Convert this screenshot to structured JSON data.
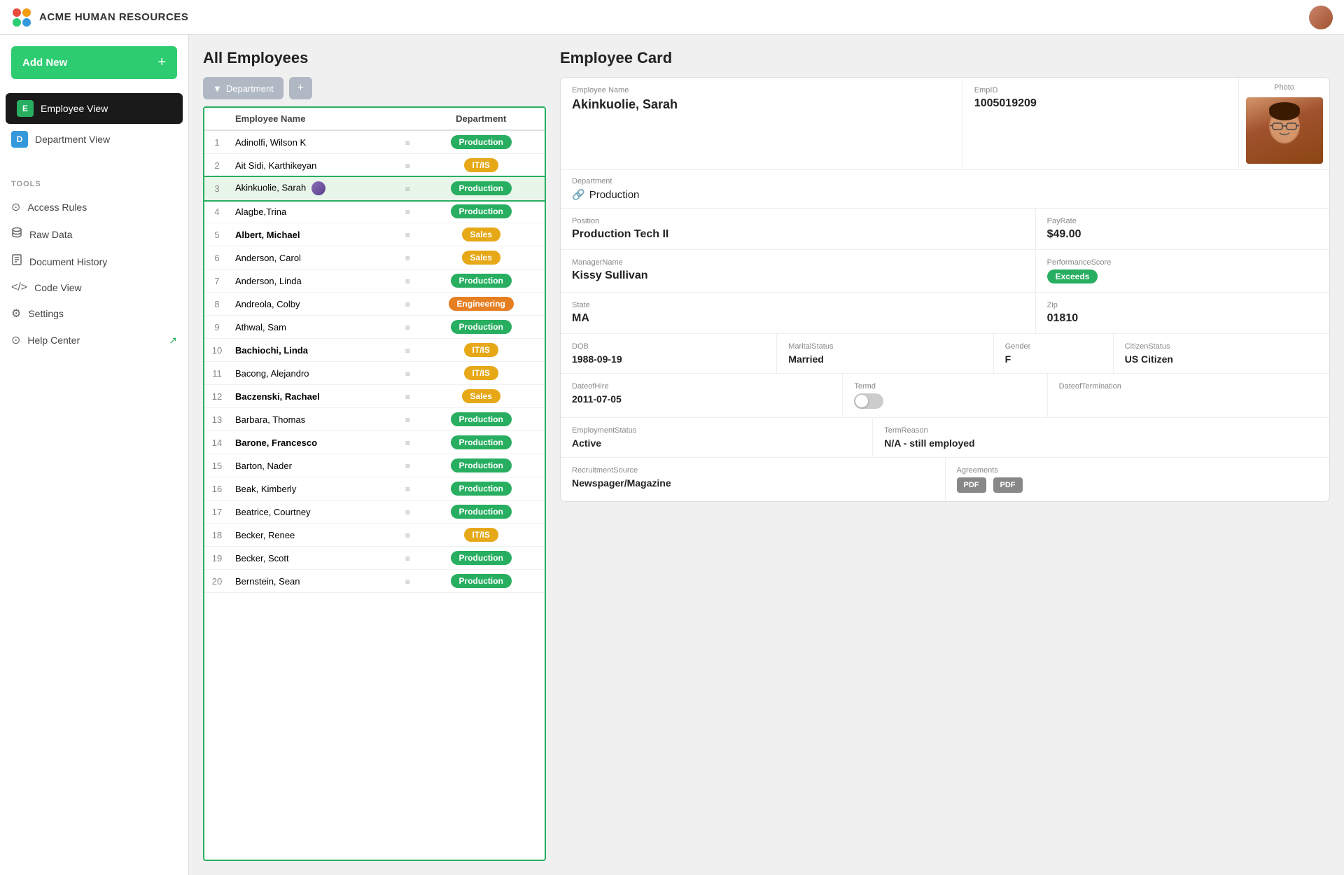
{
  "app": {
    "title": "ACME Human Resources"
  },
  "sidebar": {
    "add_new_label": "Add New",
    "nav_items": [
      {
        "id": "employee-view",
        "icon": "E",
        "label": "Employee View",
        "active": true
      },
      {
        "id": "department-view",
        "icon": "D",
        "label": "Department View",
        "active": false
      }
    ],
    "tools_heading": "TOOLS",
    "tool_items": [
      {
        "id": "access-rules",
        "icon": "⊙",
        "label": "Access Rules"
      },
      {
        "id": "raw-data",
        "icon": "⬡",
        "label": "Raw Data"
      },
      {
        "id": "document-history",
        "icon": "⊞",
        "label": "Document History"
      },
      {
        "id": "code-view",
        "icon": "</>",
        "label": "Code View"
      },
      {
        "id": "settings",
        "icon": "⚙",
        "label": "Settings"
      },
      {
        "id": "help-center",
        "icon": "⊙",
        "label": "Help Center"
      }
    ]
  },
  "employee_list": {
    "title": "All Employees",
    "filter_label": "Department",
    "columns": [
      "Employee Name",
      "Department"
    ],
    "employees": [
      {
        "num": 1,
        "name": "Adinolfi, Wilson  K",
        "dept": "Production",
        "dept_type": "production",
        "bold": false
      },
      {
        "num": 2,
        "name": "Ait Sidi, Karthikeyan",
        "dept": "IT/IS",
        "dept_type": "itis",
        "bold": false
      },
      {
        "num": 3,
        "name": "Akinkuolie, Sarah",
        "dept": "Production",
        "dept_type": "production",
        "bold": false,
        "selected": true
      },
      {
        "num": 4,
        "name": "Alagbe,Trina",
        "dept": "Production",
        "dept_type": "production",
        "bold": false
      },
      {
        "num": 5,
        "name": "Albert, Michael",
        "dept": "Sales",
        "dept_type": "sales",
        "bold": true
      },
      {
        "num": 6,
        "name": "Anderson, Carol",
        "dept": "Sales",
        "dept_type": "sales",
        "bold": false
      },
      {
        "num": 7,
        "name": "Anderson, Linda",
        "dept": "Production",
        "dept_type": "production",
        "bold": false
      },
      {
        "num": 8,
        "name": "Andreola, Colby",
        "dept": "Engineering",
        "dept_type": "engineering",
        "bold": false
      },
      {
        "num": 9,
        "name": "Athwal, Sam",
        "dept": "Production",
        "dept_type": "production",
        "bold": false
      },
      {
        "num": 10,
        "name": "Bachiochi, Linda",
        "dept": "IT/IS",
        "dept_type": "itis",
        "bold": true
      },
      {
        "num": 11,
        "name": "Bacong, Alejandro",
        "dept": "IT/IS",
        "dept_type": "itis",
        "bold": false
      },
      {
        "num": 12,
        "name": "Baczenski, Rachael",
        "dept": "Sales",
        "dept_type": "sales",
        "bold": true
      },
      {
        "num": 13,
        "name": "Barbara, Thomas",
        "dept": "Production",
        "dept_type": "production",
        "bold": false
      },
      {
        "num": 14,
        "name": "Barone, Francesco",
        "dept": "Production",
        "dept_type": "production",
        "bold": true
      },
      {
        "num": 15,
        "name": "Barton, Nader",
        "dept": "Production",
        "dept_type": "production",
        "bold": false
      },
      {
        "num": 16,
        "name": "Beak, Kimberly",
        "dept": "Production",
        "dept_type": "production",
        "bold": false
      },
      {
        "num": 17,
        "name": "Beatrice, Courtney",
        "dept": "Production",
        "dept_type": "production",
        "bold": false
      },
      {
        "num": 18,
        "name": "Becker, Renee",
        "dept": "IT/IS",
        "dept_type": "itis",
        "bold": false
      },
      {
        "num": 19,
        "name": "Becker, Scott",
        "dept": "Production",
        "dept_type": "production",
        "bold": false
      },
      {
        "num": 20,
        "name": "Bernstein, Sean",
        "dept": "Production",
        "dept_type": "production",
        "bold": false
      }
    ]
  },
  "employee_card": {
    "title": "Employee Card",
    "fields": {
      "employee_name_label": "Employee Name",
      "employee_name": "Akinkuolie, Sarah",
      "emp_id_label": "EmpID",
      "emp_id": "1005019209",
      "photo_label": "Photo",
      "department_label": "Department",
      "department": "Production",
      "position_label": "Position",
      "position": "Production Tech II",
      "pay_rate_label": "PayRate",
      "pay_rate": "$49.00",
      "manager_name_label": "ManagerName",
      "manager_name": "Kissy Sullivan",
      "performance_score_label": "PerformanceScore",
      "performance_score": "Exceeds",
      "state_label": "State",
      "state": "MA",
      "zip_label": "Zip",
      "zip": "01810",
      "dob_label": "DOB",
      "dob": "1988-09-19",
      "marital_status_label": "MaritalStatus",
      "marital_status": "Married",
      "gender_label": "Gender",
      "gender": "F",
      "citizen_status_label": "CitizenStatus",
      "citizen_status": "US Citizen",
      "date_of_hire_label": "DateofHire",
      "date_of_hire": "2011-07-05",
      "termd_label": "Termd",
      "termd": false,
      "date_of_termination_label": "DateofTermination",
      "date_of_termination": "",
      "employment_status_label": "EmploymentStatus",
      "employment_status": "Active",
      "term_reason_label": "TermReason",
      "term_reason": "N/A - still employed",
      "recruitment_source_label": "RecruitmentSource",
      "recruitment_source": "Newspager/Magazine",
      "agreements_label": "Agreements",
      "pdf_btn1": "PDF",
      "pdf_btn2": "PDF"
    }
  }
}
